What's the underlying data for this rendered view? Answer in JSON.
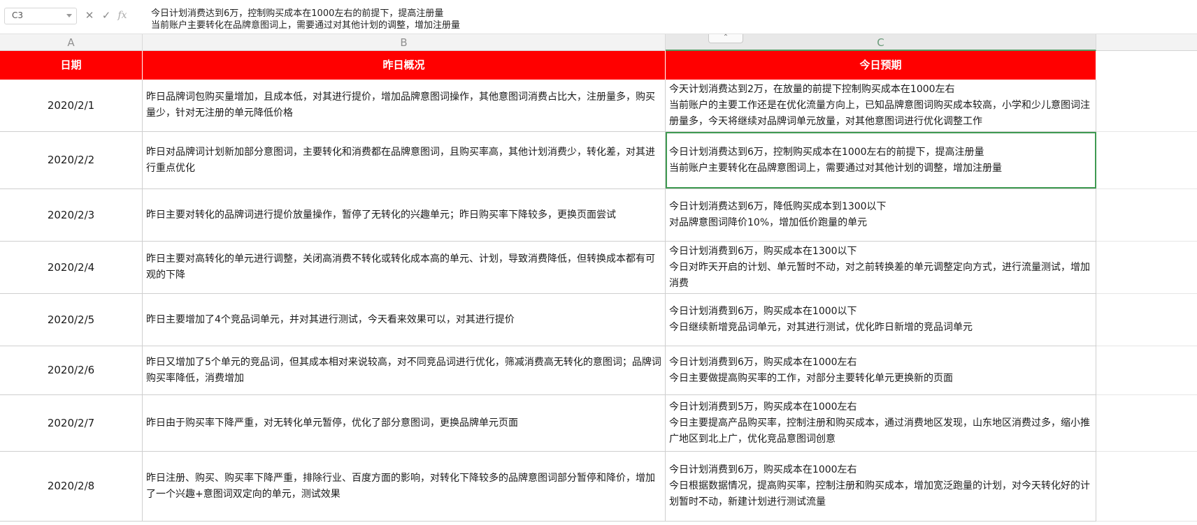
{
  "formula_bar": {
    "name_box": "C3",
    "cancel_icon": "close-icon",
    "confirm_icon": "check-icon",
    "fx_label": "fx",
    "content_lines": [
      "今日计划消费达到6万，控制购买成本在1000左右的前提下，提高注册量",
      "当前账户主要转化在品牌意图词上，需要通过对其他计划的调整，增加注册量"
    ]
  },
  "columns": {
    "a": "A",
    "b": "B",
    "c": "C"
  },
  "headers": {
    "date": "日期",
    "yesterday": "昨日概况",
    "today": "今日预期"
  },
  "colors": {
    "header_bg": "#ff0000",
    "header_text": "#ffffff",
    "selection": "#3f9a52"
  },
  "selected_cell": "C3",
  "rows": [
    {
      "date": "2020/2/1",
      "yesterday": [
        "昨日品牌词包购买量增加，且成本低，对其进行提价，增加品牌意图词操作，其他意图词消费占比大，注册量多，购买量少，针对无注册的单元降低价格"
      ],
      "today": [
        "今天计划消费达到2万，在放量的前提下控制购买成本在1000左右",
        "当前账户的主要工作还是在优化流量方向上，已知品牌意图词购买成本较高，小学和少儿意图词注册量多，今天将继续对品牌词单元放量，对其他意图词进行优化调整工作"
      ]
    },
    {
      "date": "2020/2/2",
      "yesterday": [
        "昨日对品牌词计划新加部分意图词，主要转化和消费都在品牌意图词，且购买率高，其他计划消费少，转化差，对其进行重点优化"
      ],
      "today": [
        "今日计划消费达到6万，控制购买成本在1000左右的前提下，提高注册量",
        "当前账户主要转化在品牌意图词上，需要通过对其他计划的调整，增加注册量"
      ]
    },
    {
      "date": "2020/2/3",
      "yesterday": [
        "昨日主要对转化的品牌词进行提价放量操作，暂停了无转化的兴趣单元；昨日购买率下降较多，更换页面尝试"
      ],
      "today": [
        "今日计划消费达到6万，降低购买成本到1300以下",
        "对品牌意图词降价10%，增加低价跑量的单元"
      ]
    },
    {
      "date": "2020/2/4",
      "yesterday": [
        "昨日主要对高转化的单元进行调整，关闭高消费不转化或转化成本高的单元、计划，导致消费降低，但转换成本都有可观的下降"
      ],
      "today": [
        "今日计划消费到6万，购买成本在1300以下",
        "今日对昨天开启的计划、单元暂时不动，对之前转换差的单元调整定向方式，进行流量测试，增加消费"
      ]
    },
    {
      "date": "2020/2/5",
      "yesterday": [
        "昨日主要增加了4个竞品词单元，并对其进行测试，今天看来效果可以，对其进行提价"
      ],
      "today": [
        "今日计划消费到6万，购买成本在1000以下",
        "今日继续新增竞品词单元，对其进行测试，优化昨日新增的竞品词单元"
      ]
    },
    {
      "date": "2020/2/6",
      "yesterday": [
        "昨日又增加了5个单元的竞品词，但其成本相对来说较高，对不同竞品词进行优化，筛减消费高无转化的意图词；品牌词购买率降低，消费增加"
      ],
      "today": [
        "今日计划消费到6万，购买成本在1000左右",
        "今日主要做提高购买率的工作，对部分主要转化单元更换新的页面"
      ]
    },
    {
      "date": "2020/2/7",
      "yesterday": [
        "昨日由于购买率下降严重，对无转化单元暂停，优化了部分意图词，更换品牌单元页面"
      ],
      "today": [
        "今日计划消费到5万，购买成本在1000左右",
        "今日主要提高产品购买率，控制注册和购买成本，通过消费地区发现，山东地区消费过多，缩小推广地区到北上广，优化竞品意图词创意"
      ]
    },
    {
      "date": "2020/2/8",
      "yesterday": [
        "昨日注册、购买、购买率下降严重，排除行业、百度方面的影响，对转化下降较多的品牌意图词部分暂停和降价，增加了一个兴趣+意图词双定向的单元，测试效果"
      ],
      "today": [
        "今日计划消费到6万，购买成本在1000左右",
        "今日根据数据情况，提高购买率，控制注册和购买成本，增加宽泛跑量的计划，对今天转化好的计划暂时不动，新建计划进行测试流量"
      ]
    }
  ]
}
